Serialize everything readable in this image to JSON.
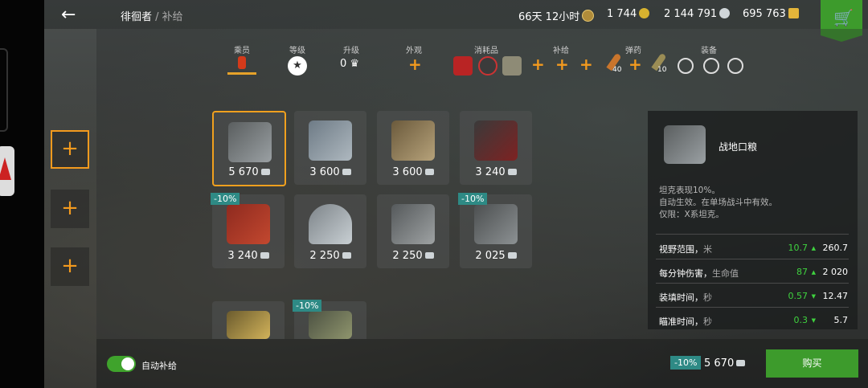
{
  "header": {
    "back_icon": "arrow-left-icon",
    "breadcrumb_active": "徘徊者",
    "breadcrumb_sep": " / ",
    "breadcrumb_current": "补给",
    "premium_time": "66天 12小时",
    "gold": "1 744",
    "silver": "2 144 791",
    "free_xp": "695 763",
    "cart_icon": "shopping-cart-icon"
  },
  "categories": [
    {
      "label": "乘员"
    },
    {
      "label": "等级"
    },
    {
      "label": "升级",
      "value": "0"
    },
    {
      "label": "外观"
    },
    {
      "label": "消耗品"
    },
    {
      "label": "补给"
    },
    {
      "label": "弹药",
      "count1": "40",
      "count2": "10"
    },
    {
      "label": "装备"
    }
  ],
  "side_plus": "+",
  "cards": [
    {
      "price": "5 670",
      "discount": ""
    },
    {
      "price": "3 600",
      "discount": ""
    },
    {
      "price": "3 600",
      "discount": ""
    },
    {
      "price": "3 240",
      "discount": ""
    },
    {
      "price": "3 240",
      "discount": "-10%"
    },
    {
      "price": "2 250",
      "discount": ""
    },
    {
      "price": "2 250",
      "discount": ""
    },
    {
      "price": "2 025",
      "discount": "-10%"
    },
    {
      "price": "",
      "discount": ""
    },
    {
      "price": "",
      "discount": "-10%"
    }
  ],
  "detail": {
    "name": "战地口粮",
    "desc1": "坦克表现10%。",
    "desc2": "自动生效。在单场战斗中有效。",
    "desc3": "仅限：X系坦克。",
    "stats": [
      {
        "label": "视野范围，",
        "unit": "米",
        "delta": "10.7",
        "value": "260.7",
        "arrow": "▲"
      },
      {
        "label": "每分钟伤害，",
        "unit": "生命值",
        "delta": "87",
        "value": "2 020",
        "arrow": "▲"
      },
      {
        "label": "装填时间，",
        "unit": "秒",
        "delta": "0.57",
        "value": "12.47",
        "arrow": "▼"
      },
      {
        "label": "瞄准时间，",
        "unit": "秒",
        "delta": "0.3",
        "value": "5.7",
        "arrow": "▼"
      }
    ]
  },
  "footer": {
    "auto_label": "自动补给",
    "discount": "-10%",
    "total": "5 670",
    "buy": "购买"
  },
  "colors": {
    "accent": "#f39a1e",
    "green": "#3d9b2c",
    "discount": "#2e8a85",
    "positive": "#3fd23f"
  }
}
